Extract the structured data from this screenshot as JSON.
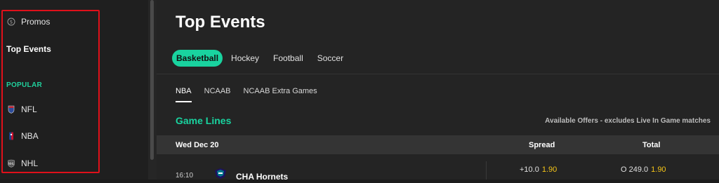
{
  "sidebar": {
    "promos_label": "Promos",
    "top_events_label": "Top Events",
    "popular_heading": "POPULAR",
    "items": [
      {
        "label": "NFL",
        "icon": "nfl-icon"
      },
      {
        "label": "NBA",
        "icon": "nba-icon"
      },
      {
        "label": "NHL",
        "icon": "nhl-icon"
      }
    ],
    "highlight_color": "#e0101a"
  },
  "main": {
    "title": "Top Events",
    "tabs": [
      {
        "label": "Basketball",
        "active": true
      },
      {
        "label": "Hockey",
        "active": false
      },
      {
        "label": "Football",
        "active": false
      },
      {
        "label": "Soccer",
        "active": false
      }
    ],
    "subtabs": [
      {
        "label": "NBA",
        "active": true
      },
      {
        "label": "NCAAB",
        "active": false
      },
      {
        "label": "NCAAB Extra Games",
        "active": false
      }
    ],
    "section_title": "Game Lines",
    "offers_note": "Available Offers - excludes Live In Game matches",
    "lines_header": {
      "date": "Wed Dec 20",
      "spread": "Spread",
      "total": "Total"
    },
    "events": [
      {
        "time": "16:10",
        "team": "CHA Hornets",
        "logo": "hornets-logo",
        "spread_line": "+10.0",
        "spread_price": "1.90",
        "total_line": "O 249.0",
        "total_price": "1.90"
      }
    ]
  },
  "colors": {
    "accent": "#19d39f",
    "price": "#f5c518",
    "background": "#242424"
  }
}
